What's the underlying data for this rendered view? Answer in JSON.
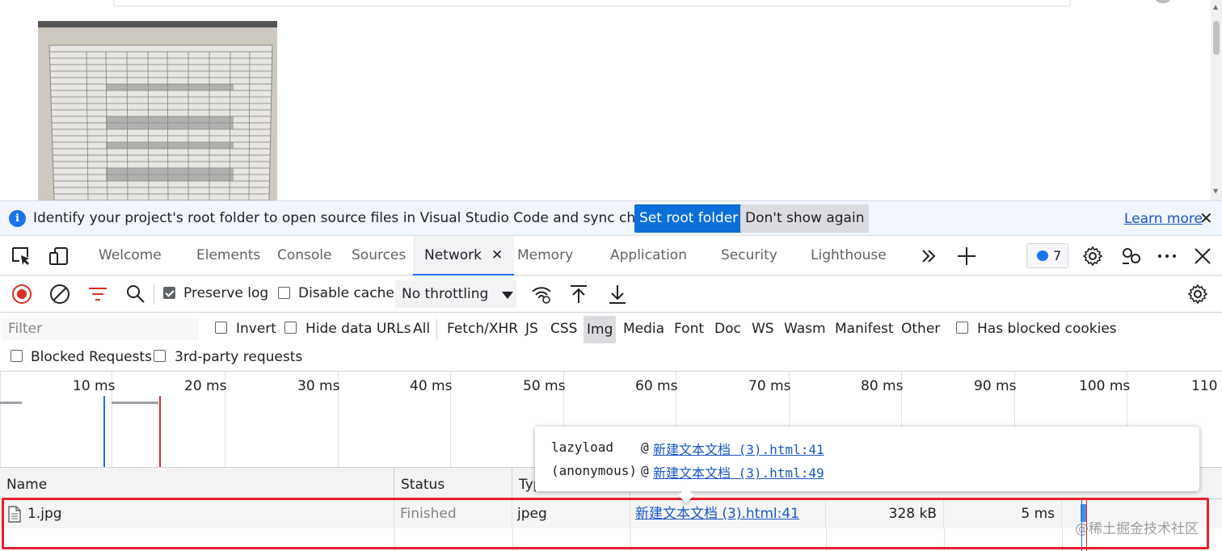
{
  "infobar": {
    "message": "Identify your project's root folder to open source files in Visual Studio Code and sync changes.",
    "primary_button": "Set root folder",
    "secondary_button": "Don't show again",
    "learn_more": "Learn more"
  },
  "tabs": {
    "items": [
      "Welcome",
      "Elements",
      "Console",
      "Sources",
      "Network",
      "Memory",
      "Application",
      "Security",
      "Lighthouse"
    ],
    "active": "Network",
    "issues_count": "7"
  },
  "network_toolbar": {
    "preserve_log": {
      "label": "Preserve log",
      "checked": true
    },
    "disable_cache": {
      "label": "Disable cache",
      "checked": false
    },
    "throttling": "No throttling"
  },
  "filter_bar": {
    "filter_placeholder": "Filter",
    "invert": "Invert",
    "hide_data_urls": "Hide data URLs",
    "types": [
      "All",
      "Fetch/XHR",
      "JS",
      "CSS",
      "Img",
      "Media",
      "Font",
      "Doc",
      "WS",
      "Wasm",
      "Manifest",
      "Other"
    ],
    "selected_type": "Img",
    "has_blocked_cookies": "Has blocked cookies",
    "blocked_requests": "Blocked Requests",
    "third_party": "3rd-party requests"
  },
  "timeline": {
    "ticks": [
      "10 ms",
      "20 ms",
      "30 ms",
      "40 ms",
      "50 ms",
      "60 ms",
      "70 ms",
      "80 ms",
      "90 ms",
      "100 ms",
      "110"
    ]
  },
  "table": {
    "columns": [
      "Name",
      "Status",
      "Typ"
    ],
    "rows": [
      {
        "name": "1.jpg",
        "status": "Finished",
        "type": "jpeg",
        "initiator": "新建文本文档 (3).html:41",
        "size": "328 kB",
        "time": "5 ms"
      }
    ]
  },
  "tooltip": {
    "frames": [
      {
        "function": "lazyload",
        "location": "新建文本文档 (3).html:41"
      },
      {
        "function": "(anonymous)",
        "location": "新建文本文档 (3).html:49"
      }
    ]
  },
  "watermark": "@稀土掘金技术社区",
  "colors": {
    "accent": "#1a73e8",
    "primary_button": "#0b6fd8",
    "record_red": "#d93025",
    "highlight": "#e8202b"
  }
}
